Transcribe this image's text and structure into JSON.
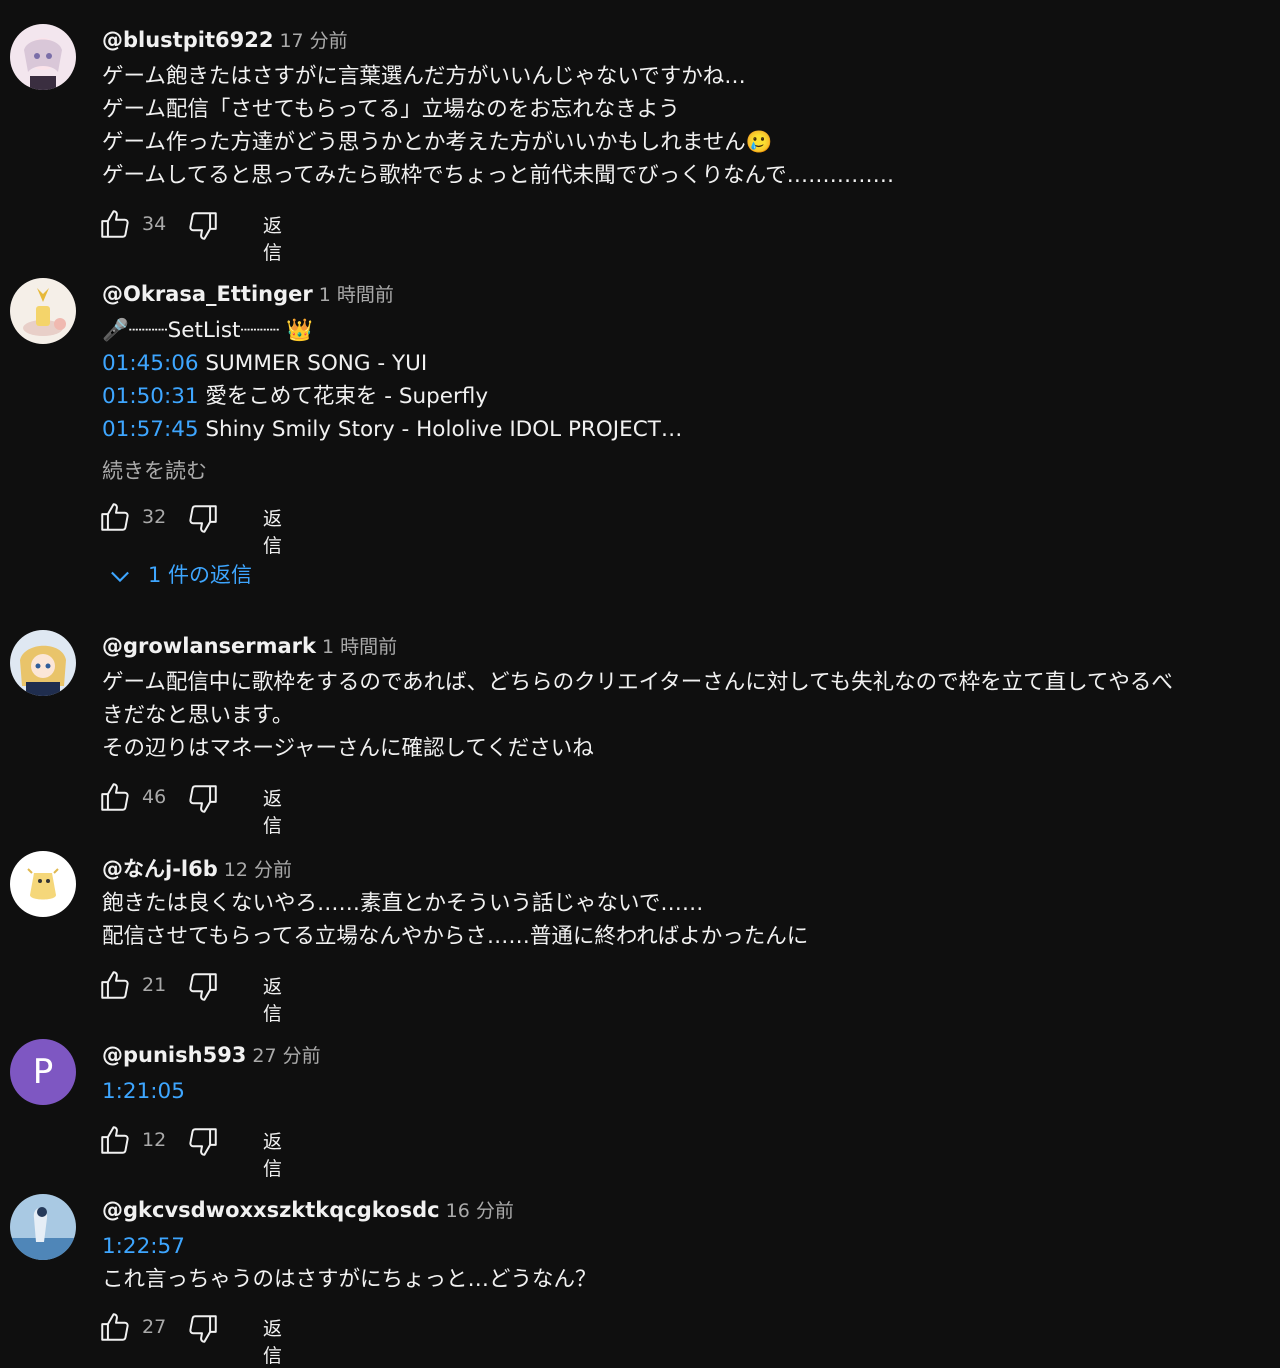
{
  "comments": [
    {
      "author": "@blustpit6922",
      "time": "17 分前",
      "lines": [
        "ゲーム飽きたはさすがに言葉選んだ方がいいんじゃないですかね…",
        "ゲーム配信「させてもらってる」立場なのをお忘れなきよう",
        "ゲーム作った方達がどう思うかとか考えた方がいいかもしれません🥲",
        "ゲームしてると思ってみたら歌枠でちょっと前代未聞でびっくりなんで……………"
      ],
      "likes": "34",
      "reply_label": "返信"
    },
    {
      "author": "@Okrasa_Ettinger",
      "time": "1 時間前",
      "setlist_line": "🎤┈┈┈SetList┈┈┈ 👑",
      "timestamp_lines": [
        {
          "ts": "01:45:06",
          "text": " SUMMER SONG - YUI"
        },
        {
          "ts": "01:50:31",
          "text": " 愛をこめて花束を - Superfly"
        },
        {
          "ts": "01:57:45",
          "text": " Shiny Smily Story - Hololive IDOL PROJECT…"
        }
      ],
      "read_more": "続きを読む",
      "likes": "32",
      "reply_label": "返信",
      "replies_toggle": "1 件の返信"
    },
    {
      "author": "@growlansermark",
      "time": "1 時間前",
      "lines": [
        "ゲーム配信中に歌枠をするのであれば、どちらのクリエイターさんに対しても失礼なので枠を立て直してやるべ",
        "きだなと思います。",
        "その辺りはマネージャーさんに確認してくださいね"
      ],
      "likes": "46",
      "reply_label": "返信"
    },
    {
      "author": "@なんj-l6b",
      "time": "12 分前",
      "lines": [
        "飽きたは良くないやろ……素直とかそういう話じゃないで……",
        "配信させてもらってる立場なんやからさ……普通に終わればよかったんに"
      ],
      "likes": "21",
      "reply_label": "返信"
    },
    {
      "author": "@punish593",
      "time": "27 分前",
      "avatar_letter": "P",
      "timestamp": "1:21:05",
      "likes": "12",
      "reply_label": "返信"
    },
    {
      "author": "@gkcvsdwoxxszktkqcgkosdc",
      "time": "16 分前",
      "timestamp": "1:22:57",
      "lines": [
        "これ言っちゃうのはさすがにちょっと…どうなん？"
      ],
      "likes": "27",
      "reply_label": "返信"
    }
  ],
  "colors": {
    "background": "#0f0f0f",
    "link_blue": "#3ea6ff",
    "secondary_text": "#aaaaaa",
    "avatar_purple": "#7e57c2"
  },
  "icons": [
    "thumb-up-icon",
    "thumb-down-icon",
    "chevron-down-icon"
  ]
}
